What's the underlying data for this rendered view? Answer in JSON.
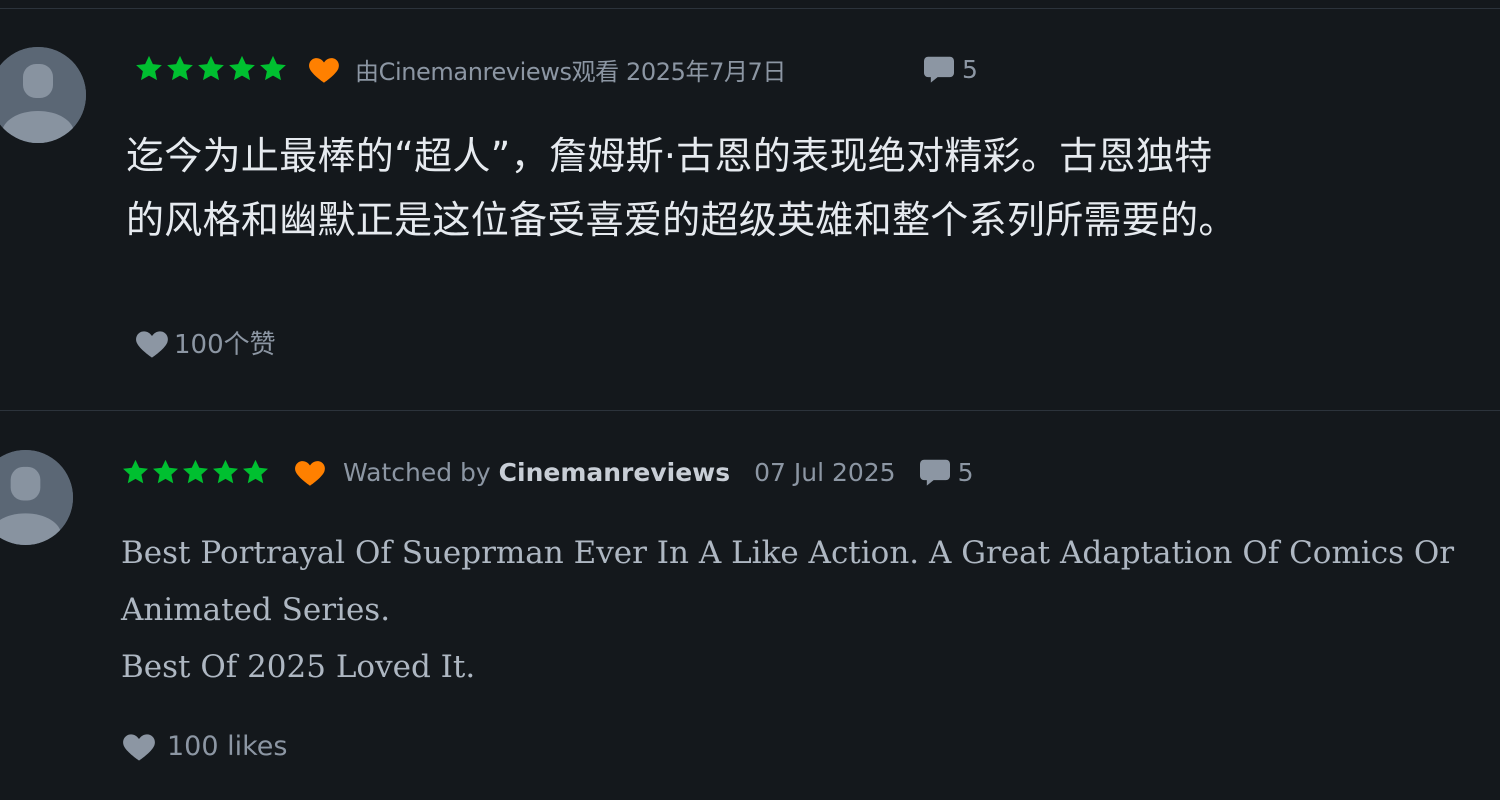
{
  "colors": {
    "background": "#14181c",
    "star_green": "#00c030",
    "liked_heart_orange": "#ff8000",
    "muted_text": "#8c96a3",
    "avatar_gray": "#5b6775"
  },
  "reviews": [
    {
      "rating_stars": 5,
      "liked": true,
      "watched_by_text": "由Cinemanreviews观看 2025年7月7日",
      "comment_count": "5",
      "body_lines": [
        "迄今为止最棒的“超人”，詹姆斯·古恩的表现绝对精彩。古恩独特",
        "的风格和幽默正是这位备受喜爱的超级英雄和整个系列所需要的。"
      ],
      "likes_text": "100个赞"
    },
    {
      "rating_stars": 5,
      "liked": true,
      "watched_prefix": "Watched by",
      "username": "Cinemanreviews",
      "date": "07 Jul 2025",
      "comment_count": "5",
      "body_lines": [
        "Best Portrayal Of Sueprman Ever In A Like Action. A Great Adaptation Of Comics Or",
        "Animated Series.",
        "Best Of 2025 Loved It."
      ],
      "likes_text": "100 likes"
    }
  ],
  "icons": {
    "star": "star-icon",
    "liked_heart": "heart-icon",
    "comment": "comment-bubble-icon",
    "like_heart": "heart-icon",
    "avatar": "default-avatar-icon"
  }
}
